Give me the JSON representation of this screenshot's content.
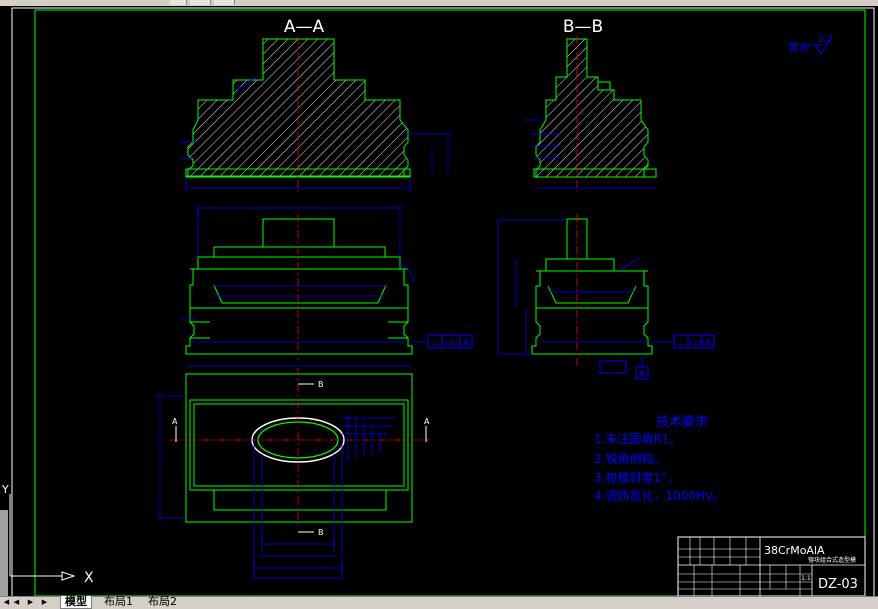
{
  "views": {
    "section_aa": "A—A",
    "section_bb": "B—B"
  },
  "roughness": {
    "label": "其余",
    "value": "3.2"
  },
  "section_marks": {
    "b_upper": "B",
    "b_lower": "B",
    "a_left": "A",
    "a_right": "A"
  },
  "tolerance_frames": {
    "flatness_front": [
      "⊥",
      "0.02",
      "A"
    ],
    "flatness_side": [
      "⊥",
      "0.02",
      "A"
    ],
    "datum_side": "A"
  },
  "tech_requirements": {
    "title": "技术要求",
    "items": [
      "1.未注圆角R1。",
      "2.锐角倒钝。",
      "3.拔模斜度1°。",
      "4.调质氮化，1000HV。"
    ]
  },
  "title_block": {
    "material": "38CrMoAlA",
    "part_name": "镕块组合式造型模",
    "drawing_no": "DZ-03",
    "scale": "1:1"
  },
  "ucs": {
    "x_label": "X",
    "y_label": "Y"
  },
  "tabs": {
    "model": "模型",
    "layout1": "布局1",
    "layout2": "布局2"
  },
  "colors": {
    "background": "#000000",
    "geometry": "#00ff00",
    "dimension": "#0000ff",
    "centerline": "#ff0000",
    "border": "#ffffff",
    "frame": "#00ff00"
  }
}
